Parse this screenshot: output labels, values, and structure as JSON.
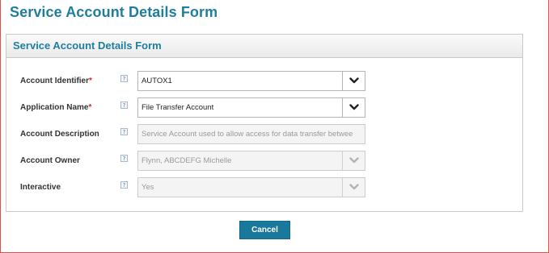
{
  "page": {
    "title": "Service Account Details Form"
  },
  "panel": {
    "title": "Service Account Details Form"
  },
  "fields": [
    {
      "label": "Account Identifier",
      "required": "*",
      "value": "AUTOX1"
    },
    {
      "label": "Application Name",
      "required": "*",
      "value": "File Transfer Account"
    },
    {
      "label": "Account Description",
      "required": "",
      "value": "Service Account used to allow access for data transfer betwee"
    },
    {
      "label": "Account Owner",
      "required": "",
      "value": "Flynn, ABCDEFG Michelle"
    },
    {
      "label": "Interactive",
      "required": "",
      "value": "Yes"
    }
  ],
  "help": {
    "glyph": "?"
  },
  "buttons": {
    "cancel": "Cancel"
  },
  "colors": {
    "accent": "#1f7ea0",
    "button": "#19799c",
    "required": "#d9242a",
    "frame": "#d9534f"
  }
}
